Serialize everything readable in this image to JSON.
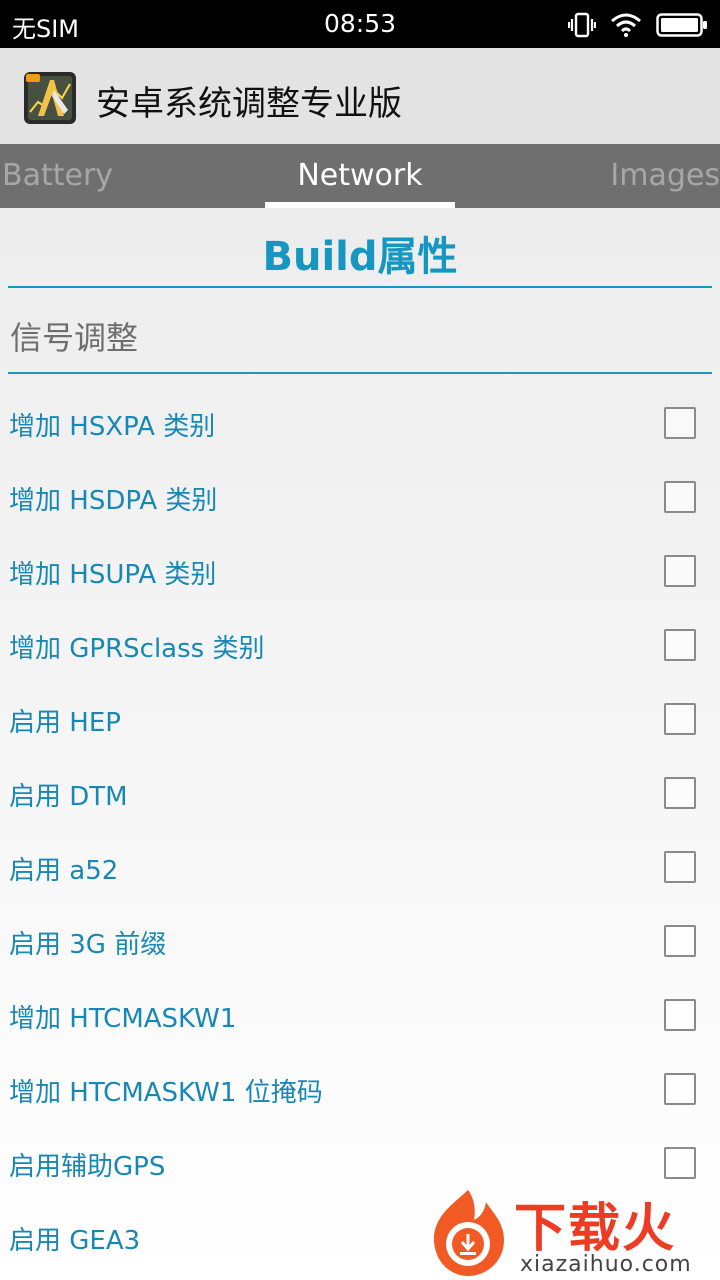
{
  "status_bar": {
    "carrier": "无SIM",
    "time": "08:53",
    "icons": [
      "vibrate-icon",
      "wifi-icon",
      "battery-icon"
    ]
  },
  "app_bar": {
    "title": "安卓系统调整专业版",
    "icon": "app-logo-icon"
  },
  "tabs": [
    {
      "label": "Battery",
      "selected": false
    },
    {
      "label": "Network",
      "selected": true
    },
    {
      "label": "Images",
      "selected": false
    }
  ],
  "section": {
    "title": "Build属性",
    "category": "信号调整"
  },
  "items": [
    {
      "label": "增加 HSXPA 类别",
      "checked": false
    },
    {
      "label": "增加 HSDPA 类别",
      "checked": false
    },
    {
      "label": "增加 HSUPA 类别",
      "checked": false
    },
    {
      "label": "增加 GPRSclass 类别",
      "checked": false
    },
    {
      "label": "启用 HEP",
      "checked": false
    },
    {
      "label": "启用 DTM",
      "checked": false
    },
    {
      "label": "启用 a52",
      "checked": false
    },
    {
      "label": "启用 3G 前缀",
      "checked": false
    },
    {
      "label": "增加 HTCMASKW1",
      "checked": false
    },
    {
      "label": "增加 HTCMASKW1 位掩码",
      "checked": false
    },
    {
      "label": "启用辅助GPS",
      "checked": false
    },
    {
      "label": "启用 GEA3",
      "checked": false
    }
  ],
  "watermark": {
    "text": "下载火",
    "url": "xiazaihuo.com"
  },
  "colors": {
    "accent": "#1696c0",
    "item_text": "#1788b5",
    "tab_bar": "#6f6f6f",
    "watermark": "#ee3b23"
  }
}
